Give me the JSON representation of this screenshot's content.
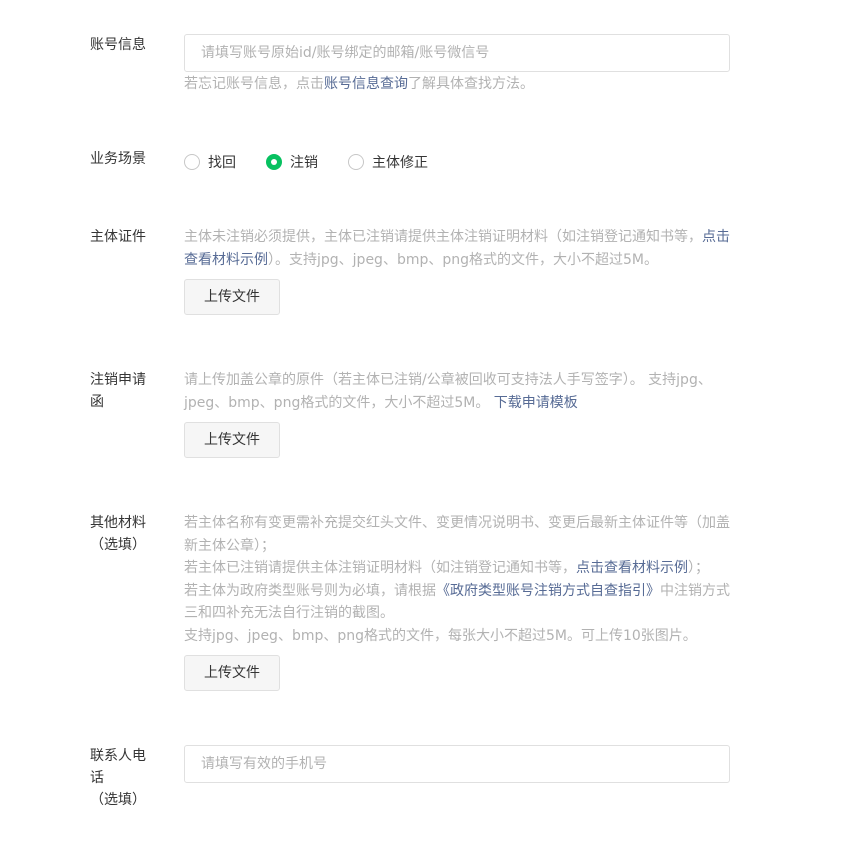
{
  "account_info": {
    "label": "账号信息",
    "placeholder": "请填写账号原始id/账号绑定的邮箱/账号微信号",
    "tip_prefix": "若忘记账号信息，点击",
    "tip_link": "账号信息查询",
    "tip_suffix": "了解具体查找方法。"
  },
  "scene": {
    "label": "业务场景",
    "options": [
      {
        "label": "找回",
        "checked": false
      },
      {
        "label": "注销",
        "checked": true
      },
      {
        "label": "主体修正",
        "checked": false
      }
    ]
  },
  "entity_cert": {
    "label": "主体证件",
    "tip_prefix": "主体未注销必须提供，主体已注销请提供主体注销证明材料（如注销登记通知书等，",
    "tip_link": "点击查看材料示例",
    "tip_suffix": "）。支持jpg、jpeg、bmp、png格式的文件，大小不超过5M。",
    "upload_label": "上传文件"
  },
  "cancel_letter": {
    "label": "注销申请\n函",
    "tip_prefix": "请上传加盖公章的原件（若主体已注销/公章被回收可支持法人手写签字）。 支持jpg、jpeg、bmp、png格式的文件，大小不超过5M。 ",
    "tip_link": "下载申请模板",
    "upload_label": "上传文件"
  },
  "other_materials": {
    "label": "其他材料\n（选填）",
    "line1": "若主体名称有变更需补充提交红头文件、变更情况说明书、变更后最新主体证件等（加盖新主体公章）；",
    "line2_prefix": "若主体已注销请提供主体注销证明材料（如注销登记通知书等，",
    "line2_link": "点击查看材料示例",
    "line2_suffix": "）；",
    "line3_prefix": "若主体为政府类型账号则为必填，请根据",
    "line3_link": "《政府类型账号注销方式自查指引》",
    "line3_suffix": "中注销方式三和四补充无法自行注销的截图。",
    "line4": "支持jpg、jpeg、bmp、png格式的文件，每张大小不超过5M。可上传10张图片。",
    "upload_label": "上传文件"
  },
  "contact_phone": {
    "label": "联系人电\n话\n（选填）",
    "placeholder": "请填写有效的手机号"
  },
  "colors": {
    "accent": "#07c160",
    "link": "#576b95",
    "tip": "#b2b2b2"
  }
}
